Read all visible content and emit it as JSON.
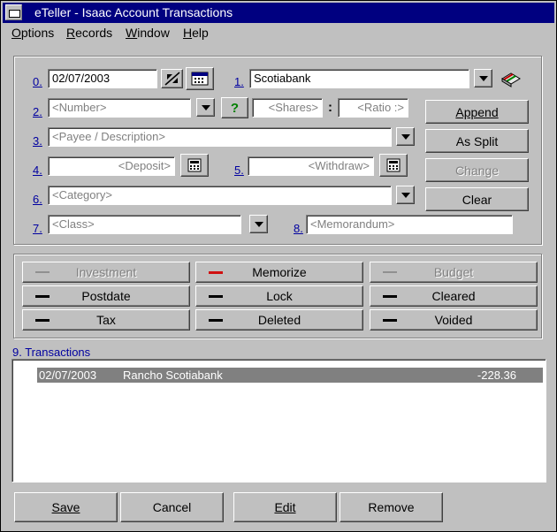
{
  "window": {
    "title": "eTeller - Isaac  Account Transactions"
  },
  "menu": [
    "Options",
    "Records",
    "Window",
    "Help"
  ],
  "form": {
    "labels": {
      "f0": "0.",
      "f1": "1.",
      "f2": "2.",
      "f3": "3.",
      "f4": "4.",
      "f5": "5.",
      "f6": "6.",
      "f7": "7.",
      "f8": "8.",
      "f9": "9. Transactions"
    },
    "date": "02/07/2003",
    "account": "Scotiabank",
    "number_ph": "<Number>",
    "shares_ph": "<Shares>",
    "ratio_ph": "<Ratio :>",
    "ratio_sep": ":",
    "payee_ph": "<Payee / Description>",
    "deposit_ph": "<Deposit>",
    "withdraw_ph": "<Withdraw>",
    "category_ph": "<Category>",
    "class_ph": "<Class>",
    "memo_ph": "<Memorandum>",
    "help_glyph": "?"
  },
  "side_buttons": {
    "append": "Append",
    "as_split": "As Split",
    "change": "Change",
    "clear": "Clear"
  },
  "toggles": {
    "investment": "Investment",
    "memorize": "Memorize",
    "budget": "Budget",
    "postdate": "Postdate",
    "lock": "Lock",
    "cleared": "Cleared",
    "tax": "Tax",
    "deleted": "Deleted",
    "voided": "Voided"
  },
  "transactions": [
    {
      "date": "02/07/2003",
      "description": "Rancho  Scotiabank",
      "amount": "-228.36"
    }
  ],
  "bottom_buttons": {
    "save": "Save",
    "cancel": "Cancel",
    "edit": "Edit",
    "remove": "Remove"
  },
  "colors": {
    "titlebar": "#000080",
    "selection": "#808080",
    "memorize_indicator": "#d01010"
  }
}
